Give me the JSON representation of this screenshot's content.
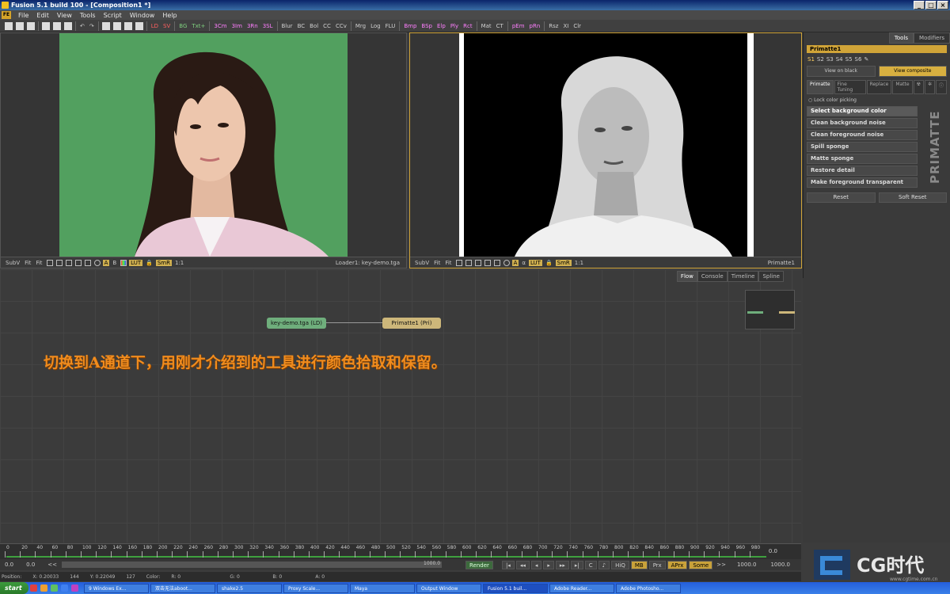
{
  "window": {
    "title": "Fusion 5.1 build 100 - [Composition1 *]",
    "controls": [
      "_",
      "□",
      "×"
    ]
  },
  "menu": {
    "logo": "FE",
    "items": [
      "File",
      "Edit",
      "View",
      "Tools",
      "Script",
      "Window",
      "Help"
    ]
  },
  "toolbar": {
    "group1": [
      "LD",
      "SV"
    ],
    "group2": [
      "BG",
      "Txt+"
    ],
    "group3": [
      "3Cm",
      "3Im",
      "3Rn",
      "3SL"
    ],
    "group4": [
      "Blur",
      "BC",
      "Bol",
      "CC",
      "CCv"
    ],
    "group5": [
      "Mrg",
      "Log",
      "FLU"
    ],
    "group6": [
      "Bmp",
      "BSp",
      "Elp",
      "Ply",
      "Rct"
    ],
    "group7": [
      "Mat",
      "CT"
    ],
    "group8": [
      "pEm",
      "pRn"
    ],
    "group9": [
      "Rsz",
      "XI",
      "Clr"
    ]
  },
  "viewer_left": {
    "subv": "SubV",
    "fit1": "Fit",
    "fit2": "Fit",
    "chan_a": "A",
    "chan_b": "B",
    "lut": "LUT",
    "smr": "SmR",
    "scale": "1:1",
    "label": "Loader1: key-demo.tga"
  },
  "viewer_right": {
    "subv": "SubV",
    "fit1": "Fit",
    "fit2": "Fit",
    "chan_a": "A",
    "alpha": "α",
    "lut": "LUT",
    "smr": "SmR",
    "scale": "1:1",
    "label": "Primatte1"
  },
  "right_panel": {
    "tabs": [
      "Tools",
      "Modifiers"
    ],
    "tool_title": "Primatte1",
    "slots": [
      "S1",
      "S2",
      "S3",
      "S4",
      "S5",
      "S6"
    ],
    "view_buttons": [
      "View on black",
      "View composite"
    ],
    "subtabs": [
      "Primatte",
      "Fine Tuning",
      "Replace",
      "Matte"
    ],
    "lock_label": "Lock color picking",
    "buttons": [
      "Select background color",
      "Clean background noise",
      "Clean foreground noise",
      "Spill sponge",
      "Matte sponge",
      "Restore detail",
      "Make foreground transparent"
    ],
    "logo_text": "PRIMATTE",
    "reset": "Reset",
    "soft_reset": "Soft Reset"
  },
  "flow": {
    "tabs": [
      "Flow",
      "Console",
      "Timeline",
      "Spline"
    ],
    "node_loader": "key-demo.tga (LD)",
    "node_primatte": "Primatte1 (Pri)",
    "annotation": "切换到A通道下，用刚才介绍到的工具进行颜色拾取和保留。"
  },
  "timeline": {
    "ticks": [
      "0",
      "20",
      "40",
      "60",
      "80",
      "100",
      "120",
      "140",
      "160",
      "180",
      "200",
      "220",
      "240",
      "260",
      "280",
      "300",
      "320",
      "340",
      "360",
      "380",
      "400",
      "420",
      "440",
      "460",
      "480",
      "500",
      "520",
      "540",
      "560",
      "580",
      "600",
      "620",
      "640",
      "660",
      "680",
      "700",
      "720",
      "740",
      "760",
      "780",
      "800",
      "820",
      "840",
      "860",
      "880",
      "900",
      "920",
      "940",
      "960",
      "980"
    ],
    "end_value": "0.0"
  },
  "transport": {
    "start": "0.0",
    "current": "0.0",
    "range_start": "<<",
    "range_end": "1000.0",
    "render": "Render",
    "hiq": "HiQ",
    "mb": "MB",
    "prx": "Prx",
    "aprx": "APrx",
    "some": "Some",
    "skip": ">>",
    "end1": "1000.0",
    "end2": "1000.0"
  },
  "status": {
    "position_label": "Position:",
    "x": "X: 0.20033",
    "x2": "144",
    "y": "Y: 0.22049",
    "y2": "127",
    "color_label": "Color:",
    "r": "R: 0",
    "g": "G: 0",
    "b": "B: 0",
    "a": "A: 0"
  },
  "taskbar": {
    "start": "start",
    "tasks": [
      "9 Windows Ex...",
      "双击无法aboot...",
      "shake2.5",
      "Proxy Scale...",
      "Maya",
      "Output Window",
      "Fusion 5.1 buil...",
      "Adobe Reader...",
      "Adobe Photosho..."
    ],
    "active_task": 6
  },
  "watermark": {
    "brand": "CG时代",
    "url": "www.cgtime.com.cn"
  },
  "colors": {
    "accent": "#d6a328",
    "green_screen": "#55a463",
    "annotation": "#f08c1e",
    "loader_node": "#6fae7c",
    "primatte_node": "#cdb77a"
  }
}
